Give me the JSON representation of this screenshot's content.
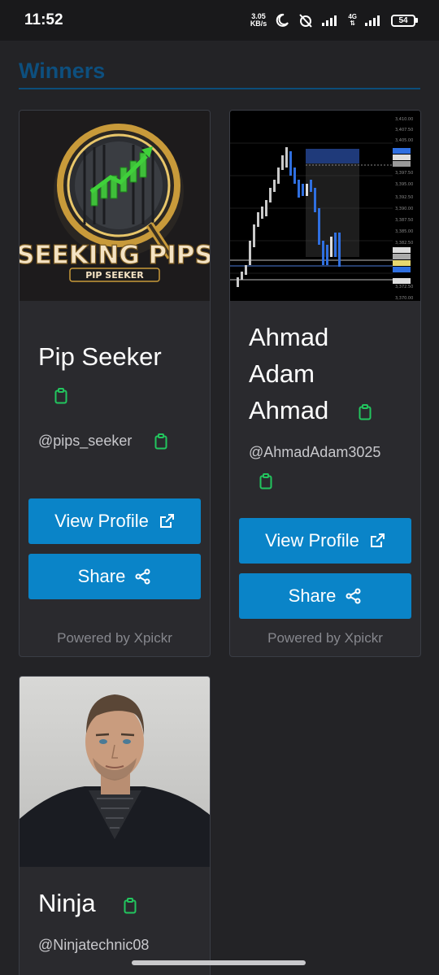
{
  "status_bar": {
    "time": "11:52",
    "net_speed_value": "3.05",
    "net_speed_unit": "KB/s",
    "network_type": "4G",
    "battery": "54"
  },
  "section": {
    "title": "Winners"
  },
  "cards": [
    {
      "name": "Pip Seeker",
      "handle": "@pips_seeker",
      "logo_text_main": "SEEKING PIPS",
      "logo_text_sub": "PIP SEEKER",
      "view_profile_label": "View Profile",
      "share_label": "Share",
      "powered_by": "Powered by Xpickr"
    },
    {
      "name_lines": [
        "Ahmad",
        "Adam",
        "Ahmad"
      ],
      "handle": "@AhmadAdam3025",
      "view_profile_label": "View Profile",
      "share_label": "Share",
      "powered_by": "Powered by Xpickr"
    },
    {
      "name": "Ninja",
      "handle": "@Ninjatechnic08"
    }
  ],
  "colors": {
    "accent": "#0a84c8",
    "section_title": "#0d4f7e",
    "clipboard_icon": "#22c55e",
    "background": "#232326"
  }
}
